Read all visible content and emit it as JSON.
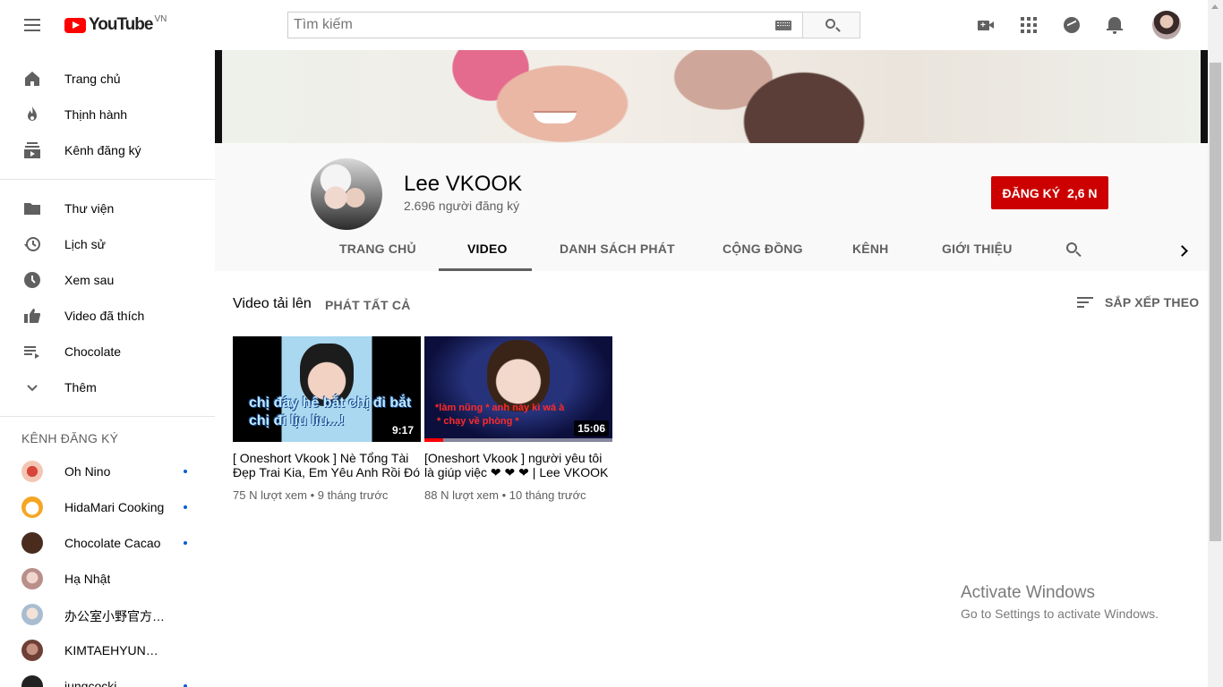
{
  "topbar": {
    "logo_text": "YouTube",
    "logo_country": "VN",
    "search_placeholder": "Tìm kiếm"
  },
  "sidebar": {
    "main_items": [
      {
        "label": "Trang chủ",
        "icon": "home-icon"
      },
      {
        "label": "Thịnh hành",
        "icon": "trending-icon"
      },
      {
        "label": "Kênh đăng ký",
        "icon": "subscriptions-icon"
      }
    ],
    "library_items": [
      {
        "label": "Thư viện",
        "icon": "library-icon"
      },
      {
        "label": "Lịch sử",
        "icon": "history-icon"
      },
      {
        "label": "Xem sau",
        "icon": "watch-later-icon"
      },
      {
        "label": "Video đã thích",
        "icon": "thumbs-up-icon"
      },
      {
        "label": "Chocolate",
        "icon": "playlist-icon"
      },
      {
        "label": "Thêm",
        "icon": "chevron-down-icon"
      }
    ],
    "subscriptions_heading": "KÊNH ĐĂNG KÝ",
    "subscriptions": [
      {
        "label": "Oh Nino",
        "new": true,
        "color": "#f3c6b4"
      },
      {
        "label": "HidaMari Cooking",
        "new": true,
        "color": "#f5a623"
      },
      {
        "label": "Chocolate Cacao",
        "new": true,
        "color": "#4a2c1f"
      },
      {
        "label": "Hạ Nhật",
        "new": false,
        "color": "#d9a9a6"
      },
      {
        "label": "办公室小野官方频道",
        "new": false,
        "color": "#c9d6e3"
      },
      {
        "label": "KIMTAEHYUNG BTS",
        "new": false,
        "color": "#8a5a4e"
      },
      {
        "label": "jungcocki",
        "new": true,
        "color": "#222222"
      }
    ]
  },
  "channel": {
    "name": "Lee VKOOK",
    "subscribers": "2.696 người đăng ký",
    "subscribe_label": "ĐĂNG KÝ",
    "subscribe_count": "2,6 N",
    "subscribe_color": "#cc0000",
    "tabs": [
      "TRANG CHỦ",
      "VIDEO",
      "DANH SÁCH PHÁT",
      "CỘNG ĐỒNG",
      "KÊNH",
      "GIỚI THIỆU"
    ],
    "active_tab": "VIDEO"
  },
  "content": {
    "section_title": "Video tải lên",
    "play_all": "PHÁT TẤT CẢ",
    "sort_label": "SẮP XẾP THEO",
    "videos": [
      {
        "title": "[ Oneshort Vkook ] Nè Tổng Tài Đẹp Trai Kia, Em Yêu Anh Rồi Đó",
        "duration": "9:17",
        "views": "75 N lượt xem",
        "age": "9 tháng trước",
        "thumb_caption_1": "chị đây hê bắt chị đi bắt",
        "thumb_caption_2": "chị đi lịu liu...!",
        "watched_fraction": 0
      },
      {
        "title": "[Oneshort Vkook ] người yêu tôi là giúp việc ❤ ❤ ❤ | Lee VKOOK",
        "duration": "15:06",
        "views": "88 N lượt xem",
        "age": "10 tháng trước",
        "thumb_caption_1": "*làm nũng * anh này kì wá à",
        "thumb_caption_2": "* chạy về phòng *",
        "watched_fraction": 0.1
      }
    ]
  },
  "watermark": {
    "line1": "Activate Windows",
    "line2": "Go to Settings to activate Windows."
  }
}
